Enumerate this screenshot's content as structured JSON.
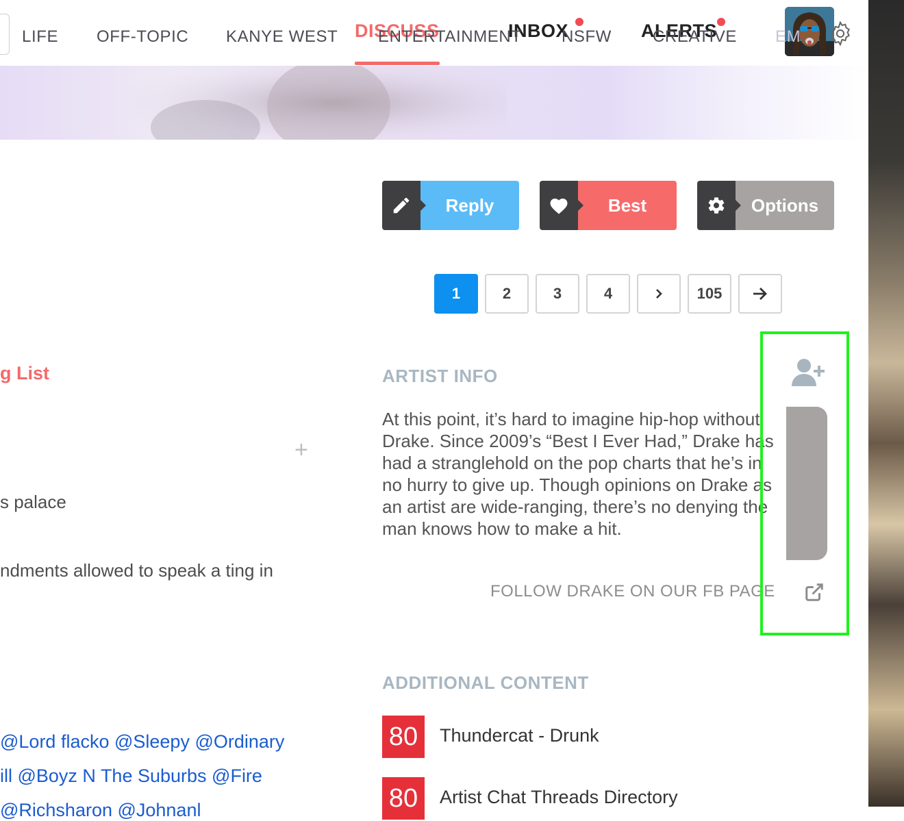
{
  "header": {
    "tabs": [
      {
        "label": "DISCUSS",
        "active": true
      },
      {
        "label": "INBOX",
        "has_notification": true
      },
      {
        "label": "ALERTS",
        "has_notification": true
      }
    ],
    "avatar_icon": "user-avatar",
    "accent_color": "#f36a6a"
  },
  "categories": [
    "LIFE",
    "OFF-TOPIC",
    "KANYE WEST",
    "ENTERTAINMENT",
    "NSFW",
    "CREATIVE",
    "EM"
  ],
  "actions": {
    "reply": {
      "label": "Reply",
      "icon": "pencil-icon",
      "color": "#5bbbf7"
    },
    "best": {
      "label": "Best",
      "icon": "heart-icon",
      "color": "#f66a6a"
    },
    "options": {
      "label": "Options",
      "icon": "gear-icon",
      "color": "#a7a3a3"
    }
  },
  "pagination": {
    "pages": [
      "1",
      "2",
      "3",
      "4"
    ],
    "current": "1",
    "last": "105"
  },
  "left": {
    "list_link": "g List",
    "plus": "+",
    "line_palace": "s palace",
    "line_commandments": "ndments allowed to speak a ting in",
    "mentions": [
      "@Lord flacko @Sleepy @Ordinary",
      "ill @Boyz N The Suburbs @Fire",
      "@Richsharon @Johnanl"
    ]
  },
  "artist_info": {
    "title": "ARTIST INFO",
    "body": "At this point, it’s hard to imagine hip-hop without Drake. Since 2009’s “Best I Ever Had,” Drake has had a stranglehold on the pop charts that he’s in no hurry to give up. Though opinions on Drake as an artist are wide-ranging, there’s no denying the man knows how to make a hit.",
    "follow_label": "FOLLOW DRAKE ON OUR FB PAGE"
  },
  "additional_content": {
    "title": "ADDITIONAL CONTENT",
    "items": [
      {
        "score": "80",
        "title": "Thundercat - Drunk"
      },
      {
        "score": "80",
        "title": "Artist Chat Threads Directory"
      }
    ]
  }
}
